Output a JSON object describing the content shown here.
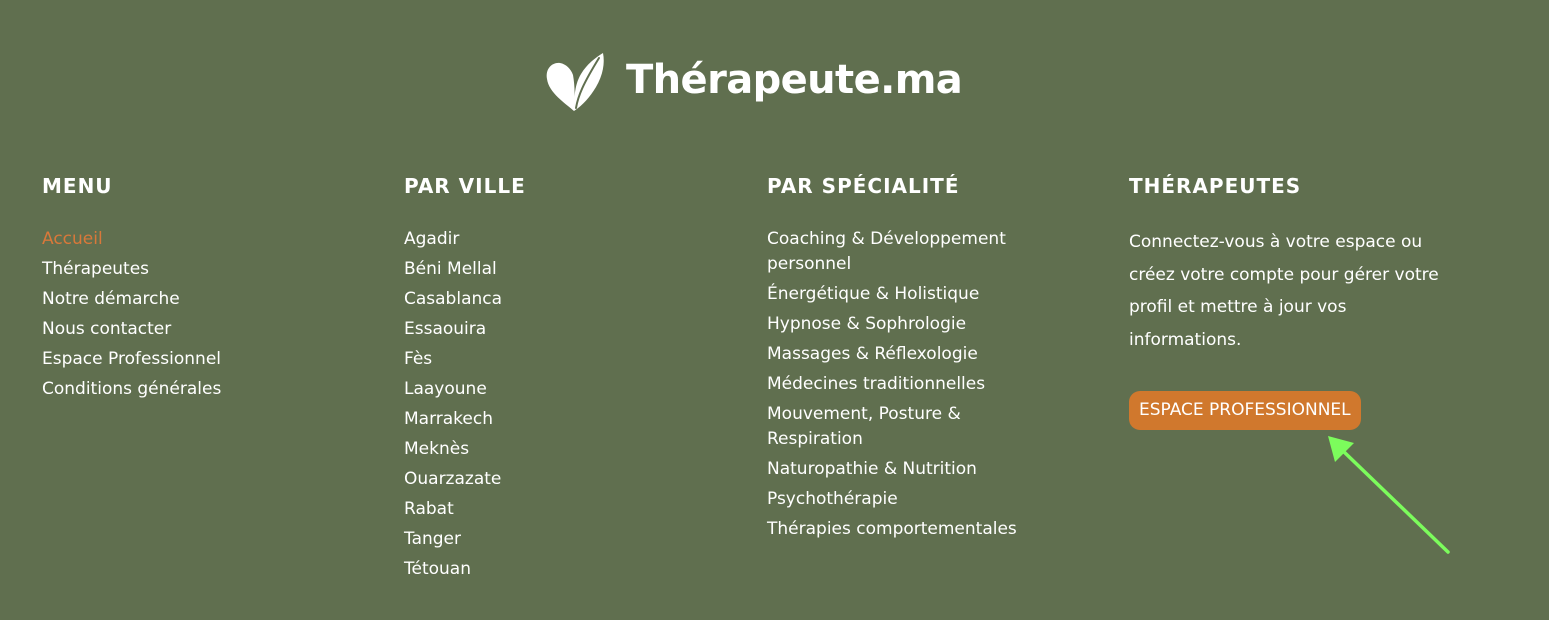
{
  "brand": {
    "logo_icon": "heart-leaf-icon",
    "name": "Thérapeute.ma"
  },
  "menu": {
    "title": "MENU",
    "items": [
      {
        "label": "Accueil",
        "active": true
      },
      {
        "label": "Thérapeutes"
      },
      {
        "label": "Notre démarche"
      },
      {
        "label": "Nous contacter"
      },
      {
        "label": "Espace Professionnel"
      },
      {
        "label": "Conditions générales"
      }
    ]
  },
  "par_ville": {
    "title": "PAR VILLE",
    "items": [
      {
        "label": "Agadir"
      },
      {
        "label": "Béni Mellal"
      },
      {
        "label": "Casablanca"
      },
      {
        "label": "Essaouira"
      },
      {
        "label": "Fès"
      },
      {
        "label": "Laayoune"
      },
      {
        "label": "Marrakech"
      },
      {
        "label": "Meknès"
      },
      {
        "label": "Ouarzazate"
      },
      {
        "label": "Rabat"
      },
      {
        "label": "Tanger"
      },
      {
        "label": "Tétouan"
      }
    ]
  },
  "par_specialite": {
    "title": "PAR SPÉCIALITÉ",
    "items": [
      {
        "label": "Coaching & Développement personnel"
      },
      {
        "label": "Énergétique & Holistique"
      },
      {
        "label": "Hypnose & Sophrologie"
      },
      {
        "label": "Massages & Réflexologie"
      },
      {
        "label": "Médecines traditionnelles"
      },
      {
        "label": "Mouvement, Posture & Respiration"
      },
      {
        "label": "Naturopathie & Nutrition"
      },
      {
        "label": "Psychothérapie"
      },
      {
        "label": "Thérapies comportementales"
      }
    ]
  },
  "therapeutes": {
    "title": "THÉRAPEUTES",
    "text": "Connectez-vous à votre espace ou créez votre compte pour gérer votre profil et mettre à jour vos informations.",
    "button_label": "ESPACE PROFESSIONNEL"
  },
  "annotation": {
    "icon": "arrow-pointer-icon"
  },
  "colors": {
    "footer_bg": "#606f4f",
    "accent": "#d9783a",
    "button_bg": "#d0782d",
    "annotation": "#7cfc5c",
    "text": "#ffffff"
  }
}
